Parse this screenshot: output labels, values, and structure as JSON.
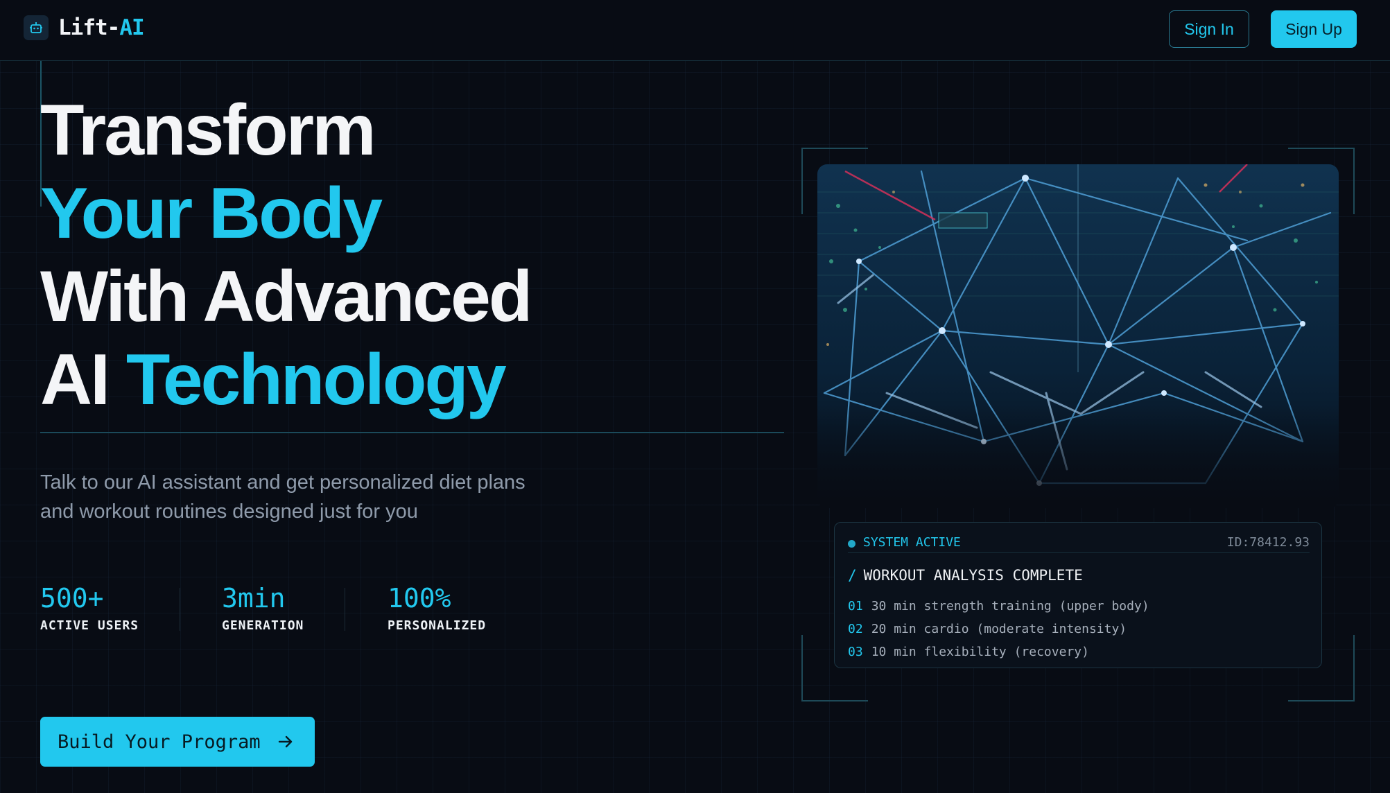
{
  "header": {
    "logo_part1": "Lift-",
    "logo_part2": "AI",
    "sign_in": "Sign In",
    "sign_up": "Sign Up"
  },
  "hero": {
    "line1": "Transform",
    "line2": "Your Body",
    "line3": "With Advanced",
    "line4_white": "AI",
    "line4_cyan": "Technology",
    "subtitle": "Talk to our AI assistant and get personalized diet plans and workout routines designed just for you"
  },
  "stats": [
    {
      "value": "500+",
      "label": "ACTIVE USERS"
    },
    {
      "value": "3min",
      "label": "GENERATION"
    },
    {
      "value": "100%",
      "label": "PERSONALIZED"
    }
  ],
  "cta": {
    "label": "Build Your Program"
  },
  "panel": {
    "status": "SYSTEM ACTIVE",
    "id": "ID:78412.93",
    "title": "WORKOUT ANALYSIS COMPLETE",
    "items": [
      {
        "num": "01",
        "text": "30 min strength training (upper body)"
      },
      {
        "num": "02",
        "text": "20 min cardio (moderate intensity)"
      },
      {
        "num": "03",
        "text": "10 min flexibility (recovery)"
      }
    ]
  },
  "colors": {
    "accent": "#22c8ee",
    "background": "#080c14",
    "text": "#f4f5f7",
    "muted": "#8f9bab"
  },
  "icons": {
    "logo": "robot-icon",
    "cta": "arrow-right-icon"
  }
}
